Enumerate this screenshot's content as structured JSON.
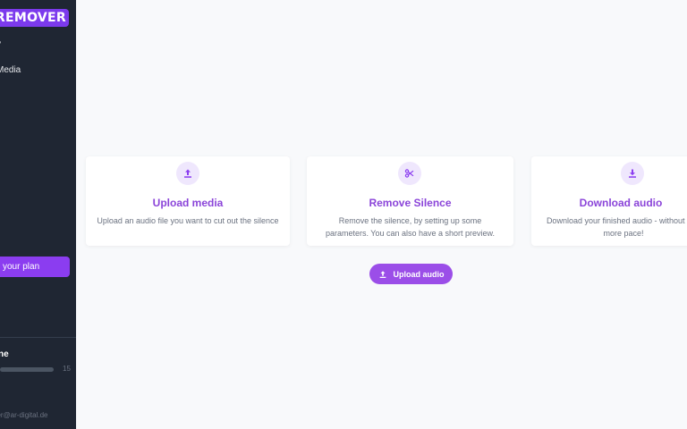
{
  "brand": {
    "logo_text": "REMOVER",
    "accent_color": "#8b3df0"
  },
  "sidebar": {
    "items": [
      {
        "label": "y"
      },
      {
        "label": "Media"
      }
    ],
    "upgrade_label": "your plan",
    "usage_label": "ne",
    "usage_count": "15",
    "user_email": "ger@ar-digital.de"
  },
  "steps": [
    {
      "icon": "upload-icon",
      "title": "Upload media",
      "description": "Upload an audio file you want to cut out the silence"
    },
    {
      "icon": "scissors-icon",
      "title": "Remove Silence",
      "description": "Remove the silence, by setting up some parameters. You can also have a short preview."
    },
    {
      "icon": "download-icon",
      "title": "Download audio",
      "description": "Download your finished audio - without and more pace!"
    }
  ],
  "upload_button": {
    "label": "Upload audio",
    "icon": "upload-icon"
  }
}
